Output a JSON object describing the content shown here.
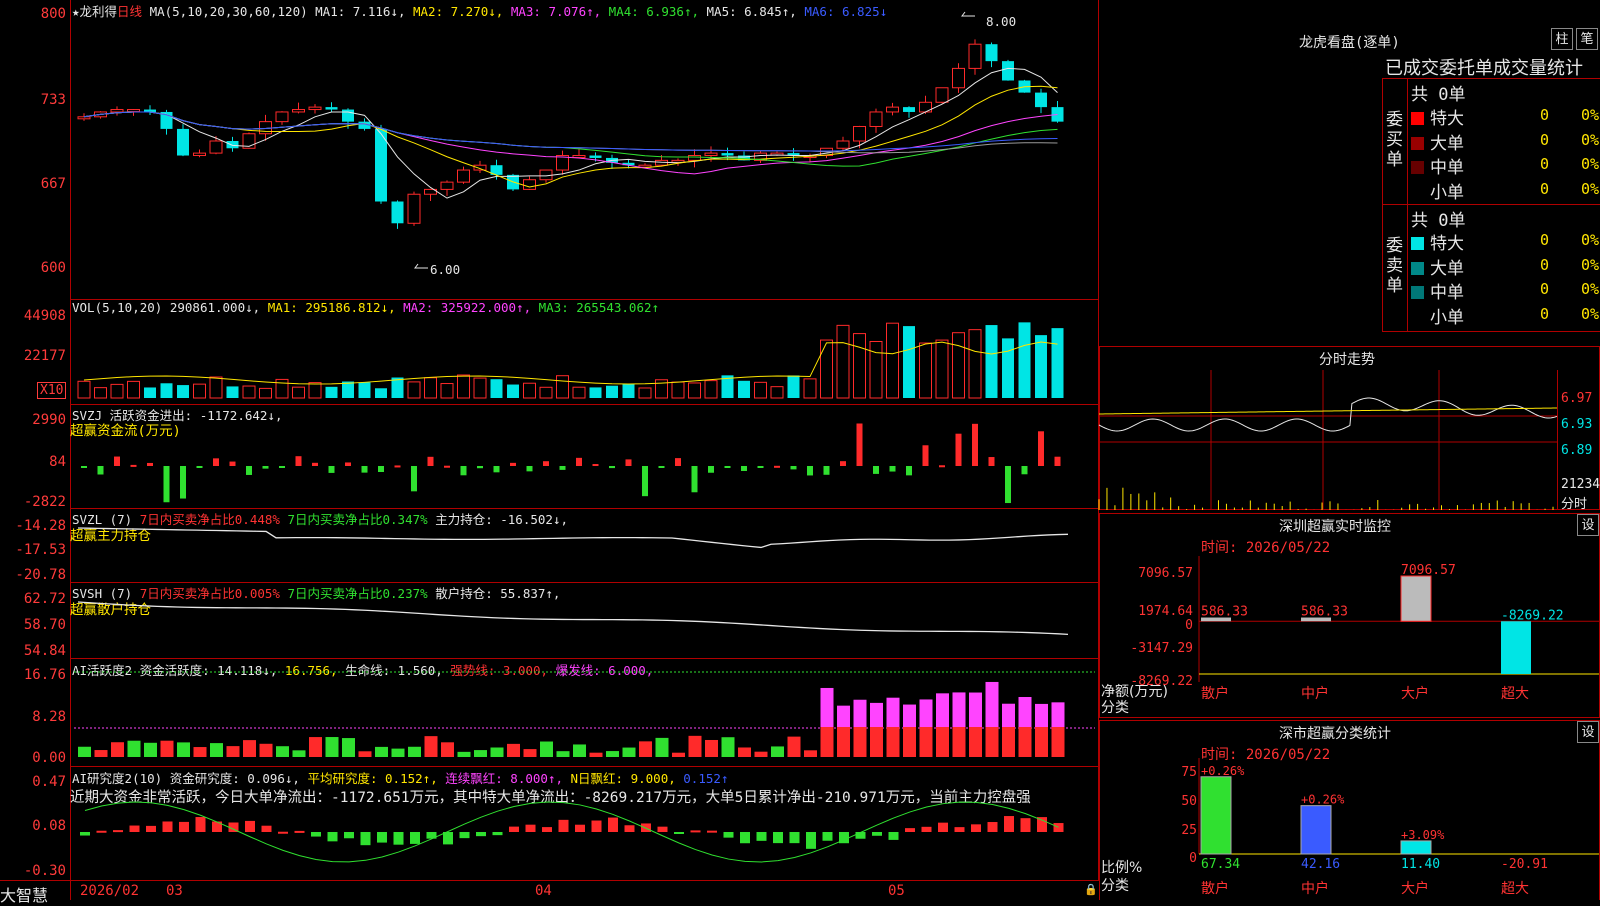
{
  "left_axis": {
    "price": [
      "800",
      "733",
      "667",
      "600"
    ],
    "vol": [
      "44908",
      "22177"
    ],
    "vol_unit": "X10",
    "svzj": [
      "2990",
      "84",
      "-2822"
    ],
    "svzl": [
      "-14.28",
      "-17.53",
      "-20.78"
    ],
    "svsh": [
      "62.72",
      "58.70",
      "54.84"
    ],
    "ai1": [
      "16.76",
      "8.28",
      "0.00"
    ],
    "ai2": [
      "0.47",
      "0.08",
      "-0.30"
    ]
  },
  "header": {
    "star": "★龙利得",
    "period": "日线",
    "ma_label": "MA(5,10,20,30,60,120)",
    "ma": [
      {
        "t": "MA1: 7.116↓,",
        "color": "#e6e6e6"
      },
      {
        "t": "MA2: 7.270↓,",
        "color": "#ffe600"
      },
      {
        "t": "MA3: 7.076↑,",
        "color": "#ff44ff"
      },
      {
        "t": "MA4: 6.936↑,",
        "color": "#30e030"
      },
      {
        "t": "MA5: 6.845↑,",
        "color": "#e6e6e6"
      },
      {
        "t": "MA6: 6.825↓",
        "color": "#3a5bff"
      }
    ],
    "high_mark": "8.00",
    "low_mark": "6.00"
  },
  "vol_header": {
    "label": "VOL(5,10,20)",
    "v": "290861.000↓,",
    "ma1": "MA1: 295186.812↓,",
    "ma2": "MA2: 325922.000↑,",
    "ma3": "MA3: 265543.062↑"
  },
  "svzj_header": {
    "label": "SVZJ",
    "t": "活跃资金进出: -1172.642↓,",
    "sub": "超赢资金流(万元)"
  },
  "svzl_header": {
    "label": "SVZL (7)",
    "a": "7日内买卖净占比0.448%",
    "b": "7日内买卖净占比0.347%",
    "c": "主力持仓: -16.502↓,",
    "sub": "超赢主力持仓"
  },
  "svsh_header": {
    "label": "SVSH (7)",
    "a": "7日内买卖净占比0.005%",
    "b": "7日内买卖净占比0.237%",
    "c": "散户持仓: 55.837↑,",
    "sub": "超赢散户持仓"
  },
  "ai1_header": {
    "label": "AI活跃度2",
    "a": "资金活跃度: 14.118↓,",
    "b": "16.756,",
    "c": "生命线: 1.560,",
    "d": "强势线: 3.000,",
    "e": "爆发线: 6.000,"
  },
  "ai2_header": {
    "label": "AI研究度2(10)",
    "a": "资金研究度: 0.096↓,",
    "b": "平均研究度: 0.152↑,",
    "c": "连续飘红: 8.000↑,",
    "d": "N日飘红: 9.000,",
    "e": "0.152↑",
    "summary": "近期大资金非常活跃，今日大单净流出：-1172.651万元，其中特大单净流出：-8269.217万元，大单5日累计净出-210.971万元，当前主力控盘强"
  },
  "date_axis": {
    "brand": "大智慧",
    "d1": "2026/02",
    "d2": "03",
    "d3": "04",
    "d4": "05"
  },
  "right": {
    "lh_title": "龙虎看盘(逐单)",
    "btn_bar": "柱",
    "btn_pen": "笔",
    "lh_sub": "已成交委托单成交量统计",
    "buy_label": "委买单",
    "sell_label": "委卖单",
    "buy_total": "共 0单",
    "sell_total": "共 0单",
    "buy_rows": [
      {
        "name": "特大",
        "color": "#ff0000",
        "n": "0",
        "p": "0%"
      },
      {
        "name": "大单",
        "color": "#990000",
        "n": "0",
        "p": "0%"
      },
      {
        "name": "中单",
        "color": "#660000",
        "n": "0",
        "p": "0%"
      },
      {
        "name": "小单",
        "color": "",
        "n": "0",
        "p": "0%"
      }
    ],
    "sell_rows": [
      {
        "name": "特大",
        "color": "#00e5e5",
        "n": "0",
        "p": "0%"
      },
      {
        "name": "大单",
        "color": "#008888",
        "n": "0",
        "p": "0%"
      },
      {
        "name": "中单",
        "color": "#007777",
        "n": "0",
        "p": "0%"
      },
      {
        "name": "小单",
        "color": "",
        "n": "0",
        "p": "0%"
      }
    ],
    "fs_title": "分时走势",
    "fs_axis": [
      "6.97",
      "6.93",
      "6.89",
      "21234",
      "分时"
    ],
    "mon_title": "深圳超赢实时监控",
    "mon_set": "设",
    "mon_time": "时间: 2026/05/22",
    "mon_axis": [
      "7096.57",
      "1974.64",
      "0",
      "-3147.29",
      "-8269.22"
    ],
    "mon_unit": "净额(万元)",
    "mon_cat": "分类",
    "cls_title": "深市超赢分类统计",
    "cls_set": "设",
    "cls_time": "时间: 2026/05/22",
    "cls_axis": [
      "75",
      "50",
      "25",
      "0"
    ],
    "cls_unit": "比例%",
    "cls_cat": "分类"
  },
  "chart_data": [
    {
      "type": "bar",
      "title": "深圳超赢实时监控",
      "ylabel": "净额(万元)",
      "categories": [
        "散户",
        "中户",
        "大户",
        "超大"
      ],
      "values": [
        586.33,
        586.33,
        7096.57,
        -8269.22
      ],
      "labels": [
        "586.33",
        "586.33",
        "7096.57",
        "-8269.22"
      ],
      "ylim": [
        -8269.22,
        7096.57
      ]
    },
    {
      "type": "bar",
      "title": "深市超赢分类统计",
      "ylabel": "比例%",
      "categories": [
        "散户",
        "中户",
        "大户",
        "超大"
      ],
      "values": [
        67.34,
        42.16,
        11.4,
        -20.91
      ],
      "labels": [
        "67.34",
        "42.16",
        "11.40",
        "-20.91"
      ],
      "changes": [
        "+0.26%",
        "+0.26%",
        "+3.09%",
        ""
      ],
      "ylim": [
        0,
        75
      ]
    }
  ]
}
